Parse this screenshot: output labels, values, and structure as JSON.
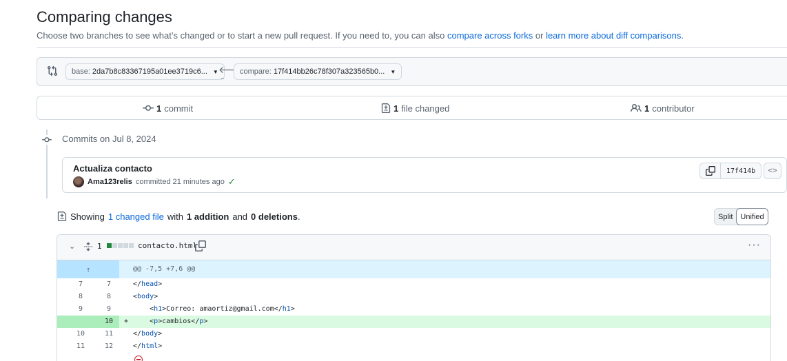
{
  "header": {
    "title": "Comparing changes",
    "description_prefix": "Choose two branches to see what’s changed or to start a new pull request. If you need to, you can also",
    "link_forks": "compare across forks",
    "description_or": "or",
    "link_learn": "learn more about diff comparisons",
    "description_suffix": "."
  },
  "range": {
    "base_label": "base:",
    "base_value": "2da7b8c83367195a01ee3719c6...",
    "compare_label": "compare:",
    "compare_value": "17f414bb26c78f307a323565b0...",
    "dots": "..."
  },
  "stats": {
    "commits_count": "1",
    "commits_label": "commit",
    "files_count": "1",
    "files_label": "file changed",
    "contributors_count": "1",
    "contributors_label": "contributor"
  },
  "timeline": {
    "date_heading": "Commits on Jul 8, 2024"
  },
  "commit": {
    "title": "Actualiza contacto",
    "author": "Ama123relis",
    "action": "committed 21 minutes ago",
    "sha": "17f414b"
  },
  "summary": {
    "showing": "Showing",
    "changed_link": "1 changed file",
    "with": "with",
    "additions": "1 addition",
    "and": "and",
    "deletions": "0 deletions",
    "period": "."
  },
  "view_toggle": {
    "split": "Split",
    "unified": "Unified",
    "selected": "Unified"
  },
  "file": {
    "change_count": "1",
    "name": "contacto.html",
    "diffstat": [
      "added",
      "neutral",
      "neutral",
      "neutral",
      "neutral"
    ],
    "hunk_header": "@@ -7,5 +7,6 @@",
    "lines": [
      {
        "old": "7",
        "new": "7",
        "marker": "",
        "code": "</head>",
        "type": "context"
      },
      {
        "old": "8",
        "new": "8",
        "marker": "",
        "code": "<body>",
        "type": "context"
      },
      {
        "old": "9",
        "new": "9",
        "marker": "",
        "code": "    <h1>Correo: amaortiz@gmail.com</h1>",
        "type": "context"
      },
      {
        "old": "",
        "new": "10",
        "marker": "+",
        "code": "    <p>cambios</p>",
        "type": "added"
      },
      {
        "old": "10",
        "new": "11",
        "marker": "",
        "code": "</body>",
        "type": "context"
      },
      {
        "old": "11",
        "new": "12",
        "marker": "",
        "code": "</html>",
        "type": "context"
      }
    ]
  },
  "colors": {
    "link": "#0969da",
    "added_bg": "#dafbe1",
    "hunk_bg": "#ddf4ff",
    "success": "#1a7f37"
  }
}
